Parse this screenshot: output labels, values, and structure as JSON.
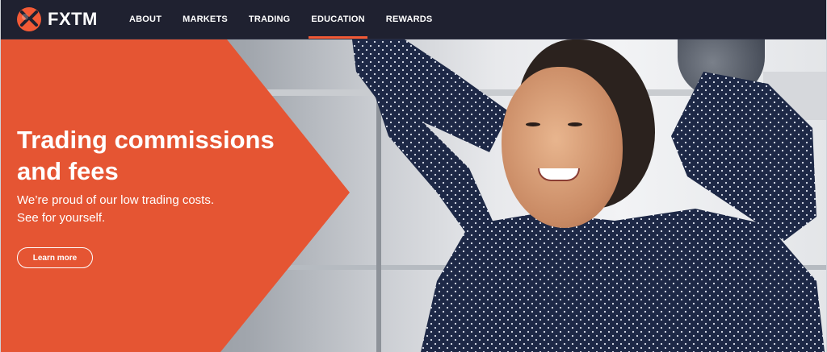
{
  "brand": {
    "name": "FXTM",
    "logo_icon": "fxtm-logo-icon",
    "accent": "#f25a36"
  },
  "nav": {
    "items": [
      {
        "label": "ABOUT",
        "active": false
      },
      {
        "label": "MARKETS",
        "active": false
      },
      {
        "label": "TRADING",
        "active": false
      },
      {
        "label": "EDUCATION",
        "active": true
      },
      {
        "label": "REWARDS",
        "active": false
      }
    ]
  },
  "hero": {
    "title_line1": "Trading commissions",
    "title_line2": "and fees",
    "subtitle_line1": "We’re proud of our low trading costs.",
    "subtitle_line2": "See for yourself.",
    "cta_label": "Learn more",
    "image_description": "woman-relaxing-photo"
  },
  "colors": {
    "nav_bg": "#1f2130",
    "hero_orange": "#f25a36",
    "text_light": "#ffffff"
  }
}
